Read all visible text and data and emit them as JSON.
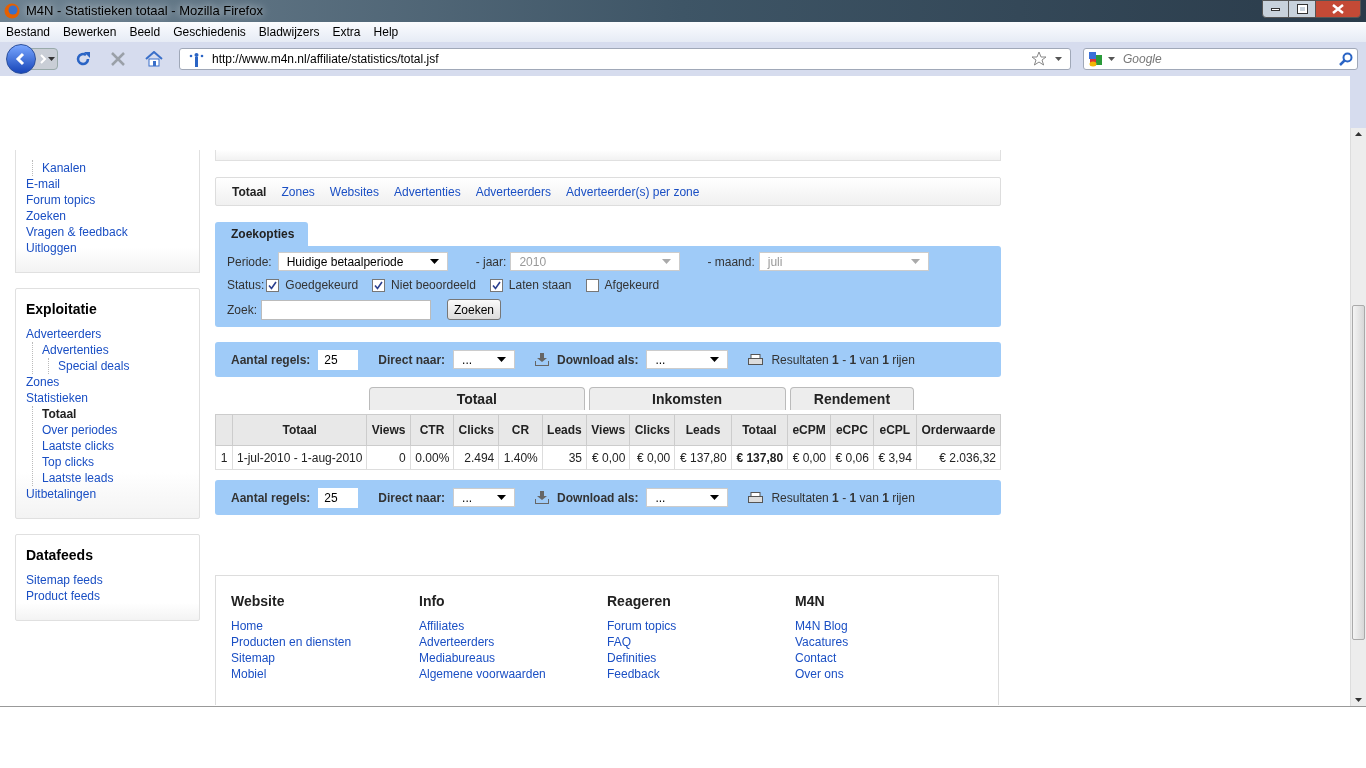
{
  "window": {
    "title": "M4N - Statistieken totaal - Mozilla Firefox"
  },
  "menu": [
    "Bestand",
    "Bewerken",
    "Beeld",
    "Geschiedenis",
    "Bladwijzers",
    "Extra",
    "Help"
  ],
  "toolbar": {
    "url": "http://www.m4n.nl/affiliate/statistics/total.jsf",
    "search_placeholder": "Google"
  },
  "sidebar": [
    {
      "cut_children": [
        {
          "label": "Kanalen",
          "selected": false
        }
      ],
      "items": [
        {
          "label": "E-mail",
          "selected": false
        },
        {
          "label": "Forum topics",
          "selected": false
        },
        {
          "label": "Zoeken",
          "selected": false
        },
        {
          "label": "Vragen & feedback",
          "selected": false
        },
        {
          "label": "Uitloggen",
          "selected": false
        }
      ]
    },
    {
      "title": "Exploitatie",
      "items": [
        {
          "label": "Adverteerders",
          "selected": false,
          "children": [
            {
              "label": "Advertenties",
              "selected": false,
              "children": [
                {
                  "label": "Special deals",
                  "selected": false
                }
              ]
            }
          ]
        },
        {
          "label": "Zones",
          "selected": false
        },
        {
          "label": "Statistieken",
          "selected": false,
          "children": [
            {
              "label": "Totaal",
              "selected": true
            },
            {
              "label": "Over periodes",
              "selected": false
            },
            {
              "label": "Laatste clicks",
              "selected": false
            },
            {
              "label": "Top clicks",
              "selected": false
            },
            {
              "label": "Laatste leads",
              "selected": false
            }
          ]
        },
        {
          "label": "Uitbetalingen",
          "selected": false
        }
      ]
    },
    {
      "title": "Datafeeds",
      "items": [
        {
          "label": "Sitemap feeds",
          "selected": false
        },
        {
          "label": "Product feeds",
          "selected": false
        }
      ]
    }
  ],
  "tabs": [
    {
      "label": "Totaal",
      "selected": true
    },
    {
      "label": "Zones",
      "selected": false
    },
    {
      "label": "Websites",
      "selected": false
    },
    {
      "label": "Advertenties",
      "selected": false
    },
    {
      "label": "Adverteerders",
      "selected": false
    },
    {
      "label": "Adverteerder(s) per zone",
      "selected": false
    }
  ],
  "search": {
    "tab": "Zoekopties",
    "period_label": "Periode:",
    "period_value": "Huidige betaalperiode",
    "year_label": "- jaar:",
    "year_value": "2010",
    "year_disabled": true,
    "month_label": "- maand:",
    "month_value": "juli",
    "month_disabled": true,
    "status_label": "Status:",
    "statuses": [
      {
        "label": "Goedgekeurd",
        "checked": true
      },
      {
        "label": "Niet beoordeeld",
        "checked": true
      },
      {
        "label": "Laten staan",
        "checked": true
      },
      {
        "label": "Afgekeurd",
        "checked": false
      }
    ],
    "query_label": "Zoek:",
    "button": "Zoeken"
  },
  "pagers": [
    {
      "rows_label": "Aantal regels:",
      "rows_value": "25",
      "jump_label": "Direct naar:",
      "jump_value": "...",
      "download_label": "Download als:",
      "download_value": "...",
      "results": "Resultaten **1** - **1** van **1** rijen"
    },
    {
      "rows_label": "Aantal regels:",
      "rows_value": "25",
      "jump_label": "Direct naar:",
      "jump_value": "...",
      "download_label": "Download als:",
      "download_value": "...",
      "results": "Resultaten **1** - **1** van **1** rijen"
    }
  ],
  "table": {
    "leading_columns": [
      "Totaal"
    ],
    "groups": [
      {
        "label": "Totaal",
        "columns": [
          "Views",
          "CTR",
          "Clicks",
          "CR",
          "Leads"
        ]
      },
      {
        "label": "Inkomsten",
        "columns": [
          "Views",
          "Clicks",
          "Leads",
          "Totaal"
        ]
      },
      {
        "label": "Rendement",
        "columns": [
          "eCPM",
          "eCPC",
          "eCPL"
        ]
      }
    ],
    "trailing_columns": [
      "Orderwaarde"
    ],
    "rows": [
      {
        "index": "1",
        "cells": [
          "1-jul-2010 - 1-aug-2010",
          "0",
          "0.00%",
          "2.494",
          "1.40%",
          "35",
          "€ 0,00",
          "€ 0,00",
          "€ 137,80",
          "**€ 137,80**",
          "€ 0,00",
          "€ 0,06",
          "€ 3,94",
          "€ 2.036,32"
        ]
      }
    ]
  },
  "footer": [
    {
      "title": "Website",
      "links": [
        "Home",
        "Producten en diensten",
        "Sitemap",
        "Mobiel"
      ]
    },
    {
      "title": "Info",
      "links": [
        "Affiliates",
        "Adverteerders",
        "Mediabureaus",
        "Algemene voorwaarden"
      ]
    },
    {
      "title": "Reageren",
      "links": [
        "Forum topics",
        "FAQ",
        "Definities",
        "Feedback"
      ]
    },
    {
      "title": "M4N",
      "links": [
        "M4N Blog",
        "Vacatures",
        "Contact",
        "Over ons"
      ]
    }
  ]
}
